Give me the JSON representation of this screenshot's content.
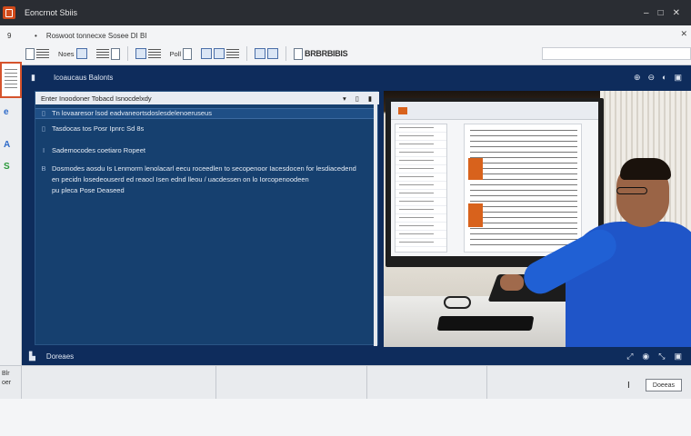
{
  "window": {
    "title": "Eoncrnot Sbiis",
    "controls": [
      "–",
      "□",
      "✕"
    ]
  },
  "ribbon": {
    "tab_num": "9",
    "tab_marker": "•",
    "tab_text": "Roswoot tonnecxe Sosee  DI BI",
    "close": "✕",
    "tools": [
      {
        "label": "Noes",
        "icon": "document-icon"
      },
      {
        "label": "",
        "icon": "format-icon"
      },
      {
        "label": "",
        "icon": "insert-icon"
      },
      {
        "label": "",
        "icon": "table-icon"
      },
      {
        "label": "Poll",
        "icon": "layout-icon"
      },
      {
        "label": "",
        "icon": "review-icon"
      },
      {
        "label": "",
        "icon": "view-icon"
      },
      {
        "label": "BRBRBIBIS",
        "icon": "styles-icon"
      }
    ]
  },
  "leftstrip": {
    "icons": [
      "e",
      "A",
      "S"
    ]
  },
  "main": {
    "header_icon": "▮",
    "header_text": "Icoaucaus  Balonts",
    "header_right": [
      "⊕",
      "⊖",
      "◐",
      "▣"
    ],
    "panel_toolbar": "Enter  Inoodoner Tobacd Isnocdelxdy",
    "panel_toolbar_right": [
      "▾",
      "▯",
      "▮"
    ],
    "rows": [
      {
        "bullet": "▯",
        "text": "Tn lovaaresor lsod eadvaneortsdoslesdelenoeruseus",
        "selected": true
      },
      {
        "bullet": "▯",
        "text": "Tasdocas tos Posr Ipnrc Sd 8s",
        "selected": false
      },
      {
        "bullet": "I",
        "text": "Sademocodes coetiaro Ropeet",
        "selected": false
      },
      {
        "bullet": "B",
        "text": "Dosmodes aosdu Is Lenmorm lenolacarl eecu roceedlen to secopenoor Iacesdocen for lesdiacedend",
        "selected": false
      },
      {
        "bullet": "",
        "text": "en pecidn losedeouserd ed reaocl Isen ednd lleou / uacdessen on lo Iorcopenoodeen",
        "selected": false
      },
      {
        "bullet": "",
        "text": "pu pleca Pose Deaseed",
        "selected": false
      }
    ],
    "footer_icon": "▙",
    "footer_text": "Doreaes",
    "footer_right": [
      "⤢",
      "◉",
      "⤡",
      "▣"
    ]
  },
  "bottom": {
    "left_label_1": "Blr",
    "left_label_2": "oer",
    "cursor": "I",
    "button": "Doeeas"
  }
}
